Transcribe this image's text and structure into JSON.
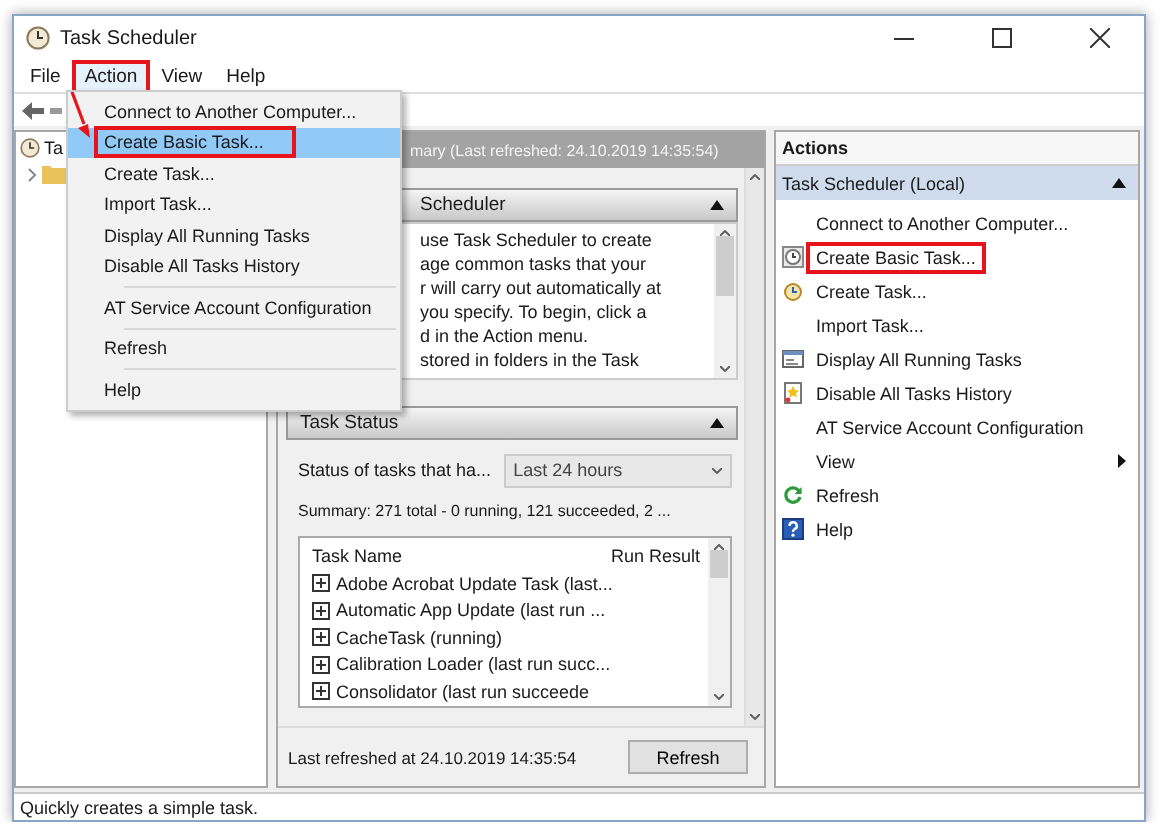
{
  "window": {
    "title": "Task Scheduler"
  },
  "menu_bar": [
    {
      "label": "File",
      "selected": false,
      "highlighted": false
    },
    {
      "label": "Action",
      "selected": true,
      "highlighted": true
    },
    {
      "label": "View",
      "selected": false,
      "highlighted": false
    },
    {
      "label": "Help",
      "selected": false,
      "highlighted": false
    }
  ],
  "action_menu": {
    "groups": [
      [
        {
          "label": "Connect to Another Computer...",
          "selected": false,
          "highlighted": false
        },
        {
          "label": "Create Basic Task...",
          "selected": true,
          "highlighted": true
        },
        {
          "label": "Create Task...",
          "selected": false,
          "highlighted": false
        },
        {
          "label": "Import Task...",
          "selected": false,
          "highlighted": false
        },
        {
          "label": "Display All Running Tasks",
          "selected": false,
          "highlighted": false
        },
        {
          "label": "Disable All Tasks History",
          "selected": false,
          "highlighted": false
        }
      ],
      [
        {
          "label": "AT Service Account Configuration",
          "selected": false,
          "highlighted": false
        }
      ],
      [
        {
          "label": "Refresh",
          "selected": false,
          "highlighted": false
        }
      ],
      [
        {
          "label": "Help",
          "selected": false,
          "highlighted": false
        }
      ]
    ]
  },
  "tree": [
    {
      "label": "Ta",
      "children": [
        {
          "expanded": false
        }
      ]
    }
  ],
  "summary": {
    "header": "mary (Last refreshed: 24.10.2019 14:35:54)",
    "overview": {
      "title": "Scheduler",
      "expanded": true,
      "lines": [
        "use Task Scheduler to create",
        "age common tasks that your",
        "r will carry out automatically at",
        "you specify. To begin, click a",
        "d in the Action menu.",
        "stored in folders in the Task"
      ]
    },
    "task_status": {
      "title": "Task Status",
      "expanded": true,
      "filter_label": "Status of tasks that ha...",
      "filter_value": "Last 24 hours",
      "summary": "Summary: 271 total - 0 running, 121 succeeded, 2 ...",
      "table": {
        "columns": [
          "Task Name",
          "Run Result"
        ],
        "rows": [
          "Adobe Acrobat Update Task (last...",
          "Automatic App Update (last run ...",
          "CacheTask (running)",
          "Calibration Loader (last run succ...",
          "Consolidator (last run succeede"
        ]
      }
    },
    "footer": {
      "refreshed": "Last refreshed at 24.10.2019 14:35:54",
      "button": "Refresh"
    }
  },
  "actions": {
    "title": "Actions",
    "group": {
      "title": "Task Scheduler (Local)",
      "expanded": true,
      "items": [
        {
          "label": "Connect to Another Computer...",
          "kind": "plain",
          "highlighted": false
        },
        {
          "label": "Create Basic Task...",
          "kind": "wizard",
          "highlighted": true
        },
        {
          "label": "Create Task...",
          "kind": "task",
          "highlighted": false
        },
        {
          "label": "Import Task...",
          "kind": "plain",
          "highlighted": false
        },
        {
          "label": "Display All Running Tasks",
          "kind": "running",
          "highlighted": false
        },
        {
          "label": "Disable All Tasks History",
          "kind": "history",
          "highlighted": false
        },
        {
          "label": "AT Service Account Configuration",
          "kind": "plain",
          "highlighted": false
        },
        {
          "label": "View",
          "kind": "plain",
          "highlighted": false,
          "submenu": true
        },
        {
          "label": "Refresh",
          "kind": "refresh",
          "highlighted": false
        },
        {
          "label": "Help",
          "kind": "help",
          "highlighted": false
        }
      ]
    }
  },
  "status_bar": "Quickly creates a simple task."
}
